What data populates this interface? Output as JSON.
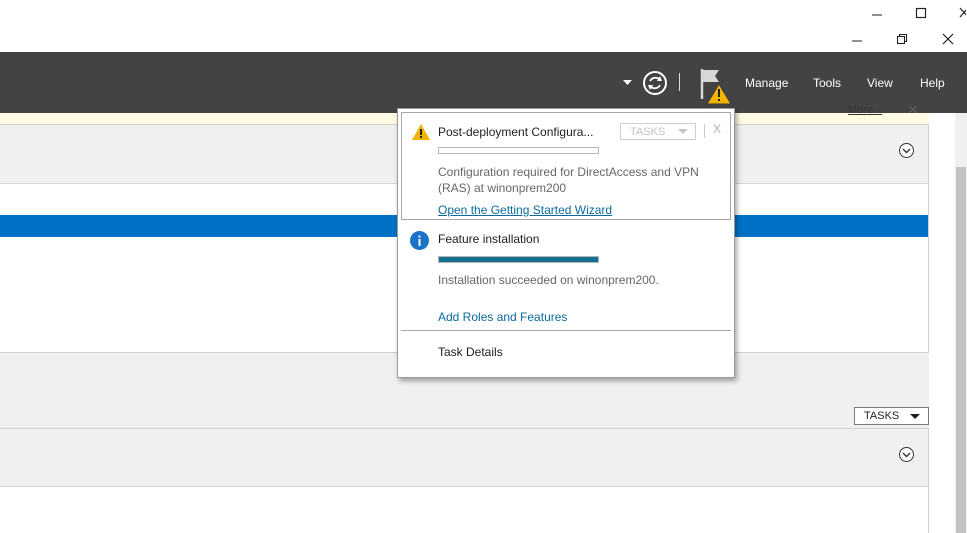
{
  "window_controls": {
    "top_row": [
      "minimize-icon",
      "maximize-icon",
      "close-icon"
    ],
    "second_row": [
      "minimize-icon",
      "restore-icon",
      "close-icon"
    ]
  },
  "menubar": {
    "items": [
      {
        "label": "Manage"
      },
      {
        "label": "Tools"
      },
      {
        "label": "View"
      },
      {
        "label": "Help"
      }
    ],
    "refresh_icon": "refresh-icon",
    "notifications_icon": "flag-warning-icon"
  },
  "background": {
    "more_link": "More...",
    "tasks_label": "TASKS"
  },
  "popup": {
    "notification1": {
      "title": "Post-deployment Configura...",
      "tasks_label": "TASKS",
      "close_label": "X",
      "progress": 0,
      "description": "Configuration required for DirectAccess and VPN (RAS) at winonprem200",
      "link": "Open the Getting Started Wizard"
    },
    "notification2": {
      "title": "Feature installation",
      "progress": 1.0,
      "description": "Installation succeeded on winonprem200.",
      "link": "Add Roles and Features"
    },
    "task_details": "Task Details"
  },
  "colors": {
    "menubar_bg": "#434343",
    "selection_blue": "#0072c6",
    "progress_fill": "#14708e",
    "link": "#0b6a9e",
    "warning": "#f0b400",
    "info": "#1a73c6"
  }
}
